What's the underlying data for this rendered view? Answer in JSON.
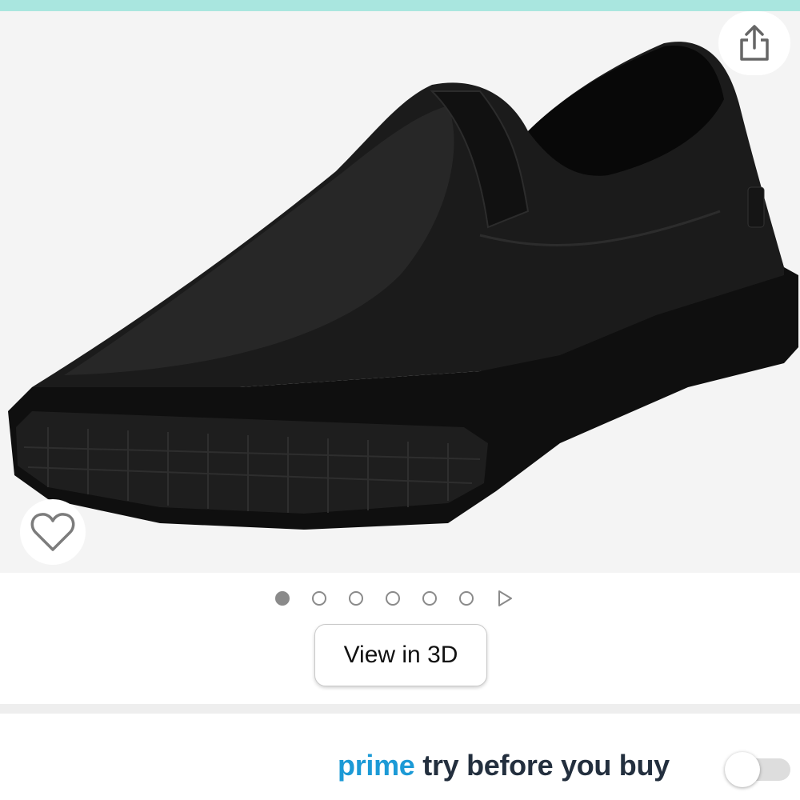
{
  "colors": {
    "top_strip": "#a9e6df",
    "gallery_background": "#f4f4f4",
    "prime_blue": "#1c9ad6",
    "prime_text": "#232f3e",
    "dot_color": "#8a8a8a"
  },
  "gallery": {
    "image_subject": "black leather slip-on shoe",
    "share_icon": "share-icon",
    "wishlist_icon": "heart-outline-icon",
    "dot_count": 6,
    "active_dot": 1,
    "next_icon": "play-triangle-icon"
  },
  "view3d": {
    "label": "View in 3D"
  },
  "prime": {
    "brand": "prime",
    "label": "try before you buy",
    "toggle_on": false
  }
}
